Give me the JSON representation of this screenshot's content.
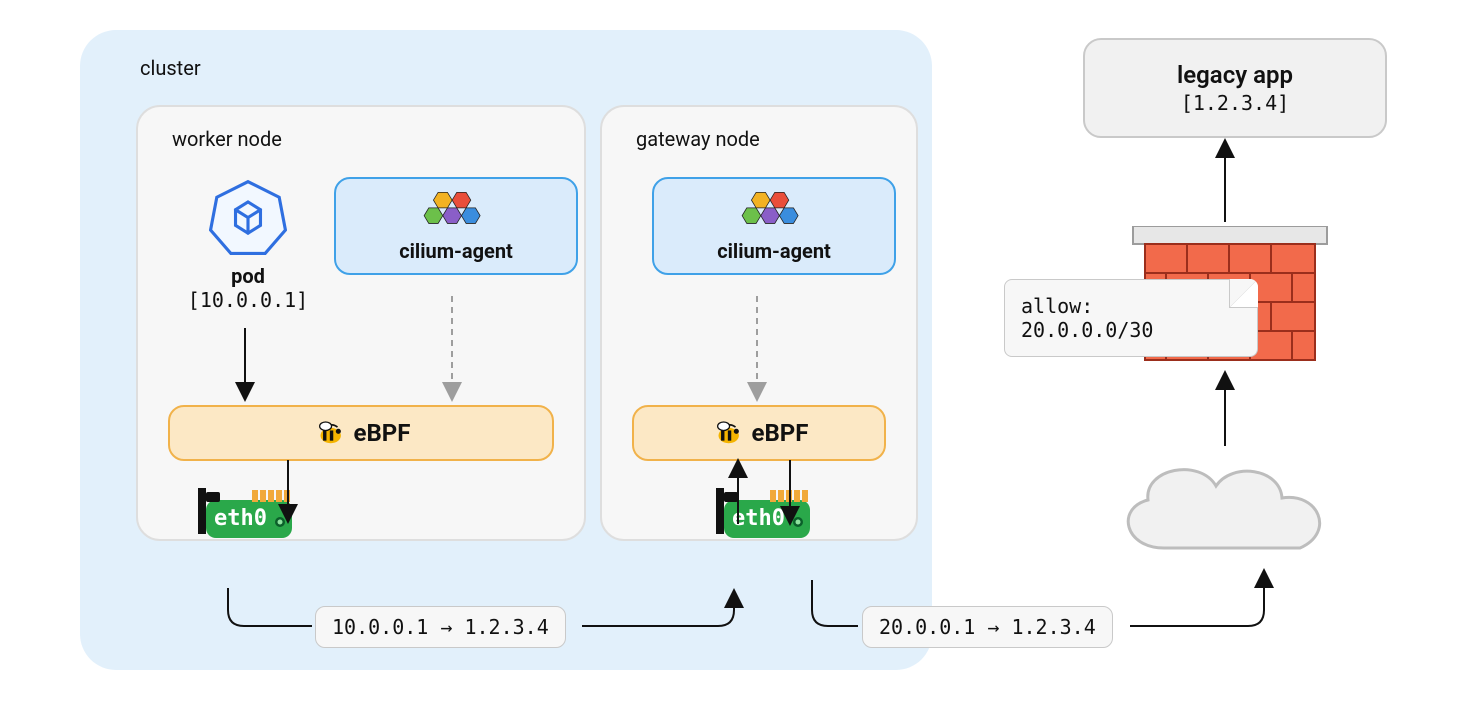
{
  "cluster": {
    "label": "cluster"
  },
  "nodes": {
    "worker": {
      "title": "worker node",
      "pod": {
        "label": "pod",
        "ip": "[10.0.0.1]"
      },
      "cilium": {
        "label": "cilium-agent"
      },
      "ebpf": {
        "label": "eBPF"
      },
      "nic": {
        "label": "eth0"
      }
    },
    "gateway": {
      "title": "gateway node",
      "cilium": {
        "label": "cilium-agent"
      },
      "ebpf": {
        "label": "eBPF"
      },
      "nic": {
        "label": "eth0"
      }
    }
  },
  "legacy": {
    "title": "legacy app",
    "address": "[1.2.3.4]"
  },
  "firewall": {
    "rule_label": "allow:",
    "rule_cidr": "20.0.0.0/30"
  },
  "routes": {
    "worker_to_gateway": "10.0.0.1 → 1.2.3.4",
    "gateway_to_cloud": "20.0.0.1 → 1.2.3.4"
  },
  "icons": {
    "kubernetes": "kubernetes-icon",
    "cilium_hive": "cilium-hive-icon",
    "bee": "bee-icon",
    "nic": "nic-icon",
    "cloud": "cloud-icon",
    "firewall": "firewall-icon"
  },
  "colors": {
    "cluster_bg": "#e2f0fb",
    "node_bg": "#f7f7f7",
    "cilium_bg": "#daebfb",
    "cilium_border": "#3fa1e8",
    "ebpf_bg": "#fce8c5",
    "ebpf_border": "#f1b24a",
    "nic_green": "#2aa84a",
    "brick": "#f26a4b"
  }
}
